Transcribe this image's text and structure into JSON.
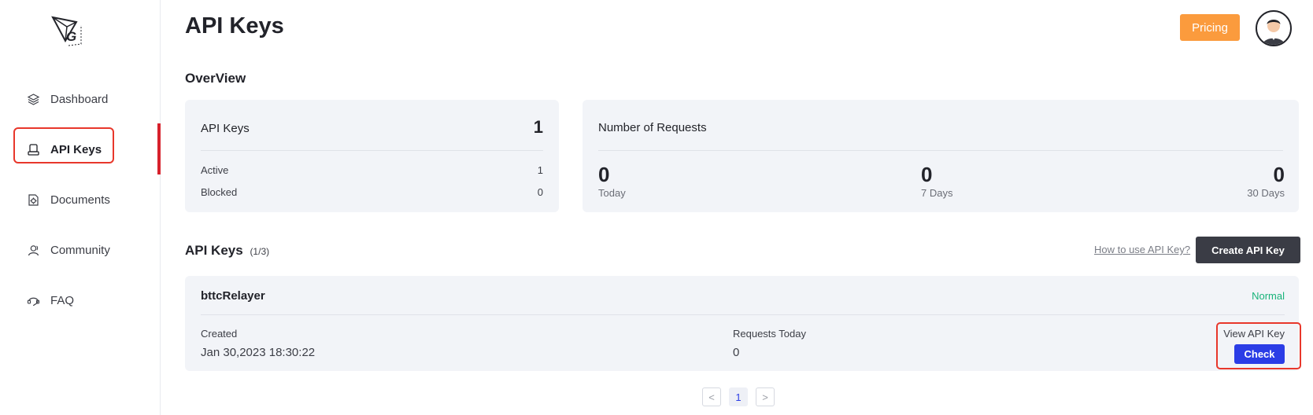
{
  "sidebar": {
    "logo_letter": "G",
    "items": [
      {
        "label": "Dashboard",
        "icon": "layers-icon"
      },
      {
        "label": "API Keys",
        "icon": "key-card-icon",
        "active": true
      },
      {
        "label": "Documents",
        "icon": "document-gear-icon"
      },
      {
        "label": "Community",
        "icon": "community-icon"
      },
      {
        "label": "FAQ",
        "icon": "faq-icon"
      }
    ]
  },
  "header": {
    "title": "API Keys",
    "pricing_label": "Pricing"
  },
  "overview": {
    "title": "OverView",
    "api_keys": {
      "label": "API Keys",
      "total": "1",
      "active_label": "Active",
      "active_value": "1",
      "blocked_label": "Blocked",
      "blocked_value": "0"
    },
    "requests": {
      "label": "Number of Requests",
      "today_value": "0",
      "today_label": "Today",
      "week_value": "0",
      "week_label": "7 Days",
      "month_value": "0",
      "month_label": "30 Days"
    }
  },
  "keys_list": {
    "title": "API Keys",
    "count": "(1/3)",
    "howto_label": "How to use API Key?",
    "create_label": "Create API Key",
    "items": [
      {
        "name": "bttcRelayer",
        "status": "Normal",
        "created_label": "Created",
        "created_value": "Jan 30,2023 18:30:22",
        "requests_label": "Requests Today",
        "requests_value": "0",
        "view_label": "View API Key",
        "check_label": "Check"
      }
    ]
  },
  "pagination": {
    "prev": "<",
    "current": "1",
    "next": ">"
  },
  "colors": {
    "accent_orange": "#fb9b3d",
    "primary_blue": "#2b3de6",
    "dark_button": "#3a3c45",
    "status_green": "#19b37a",
    "highlight_red": "#e8372b",
    "card_bg": "#f2f4f8"
  }
}
